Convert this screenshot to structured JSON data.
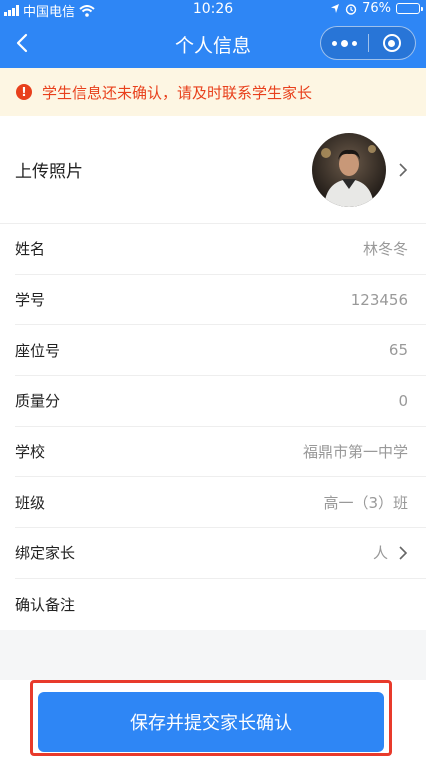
{
  "status_bar": {
    "carrier": "中国电信",
    "time": "10:26",
    "battery": "76%",
    "battery_level": 0.76
  },
  "nav": {
    "title": "个人信息"
  },
  "notice": {
    "icon": "!",
    "text": "学生信息还未确认，请及时联系学生家长"
  },
  "photo": {
    "label": "上传照片"
  },
  "fields": [
    {
      "label": "姓名",
      "value": "林冬冬"
    },
    {
      "label": "学号",
      "value": "123456"
    },
    {
      "label": "座位号",
      "value": "65"
    },
    {
      "label": "质量分",
      "value": "0"
    },
    {
      "label": "学校",
      "value": "福鼎市第一中学"
    },
    {
      "label": "班级",
      "value": "高一（3）班"
    },
    {
      "label": "绑定家长",
      "value": "人"
    },
    {
      "label": "确认备注",
      "value": ""
    }
  ],
  "submit": {
    "label": "保存并提交家长确认"
  },
  "colors": {
    "primary": "#2e86f5",
    "warning": "#e8401c",
    "notice_bg": "#fdf6e3",
    "highlight": "#e83a2b"
  }
}
